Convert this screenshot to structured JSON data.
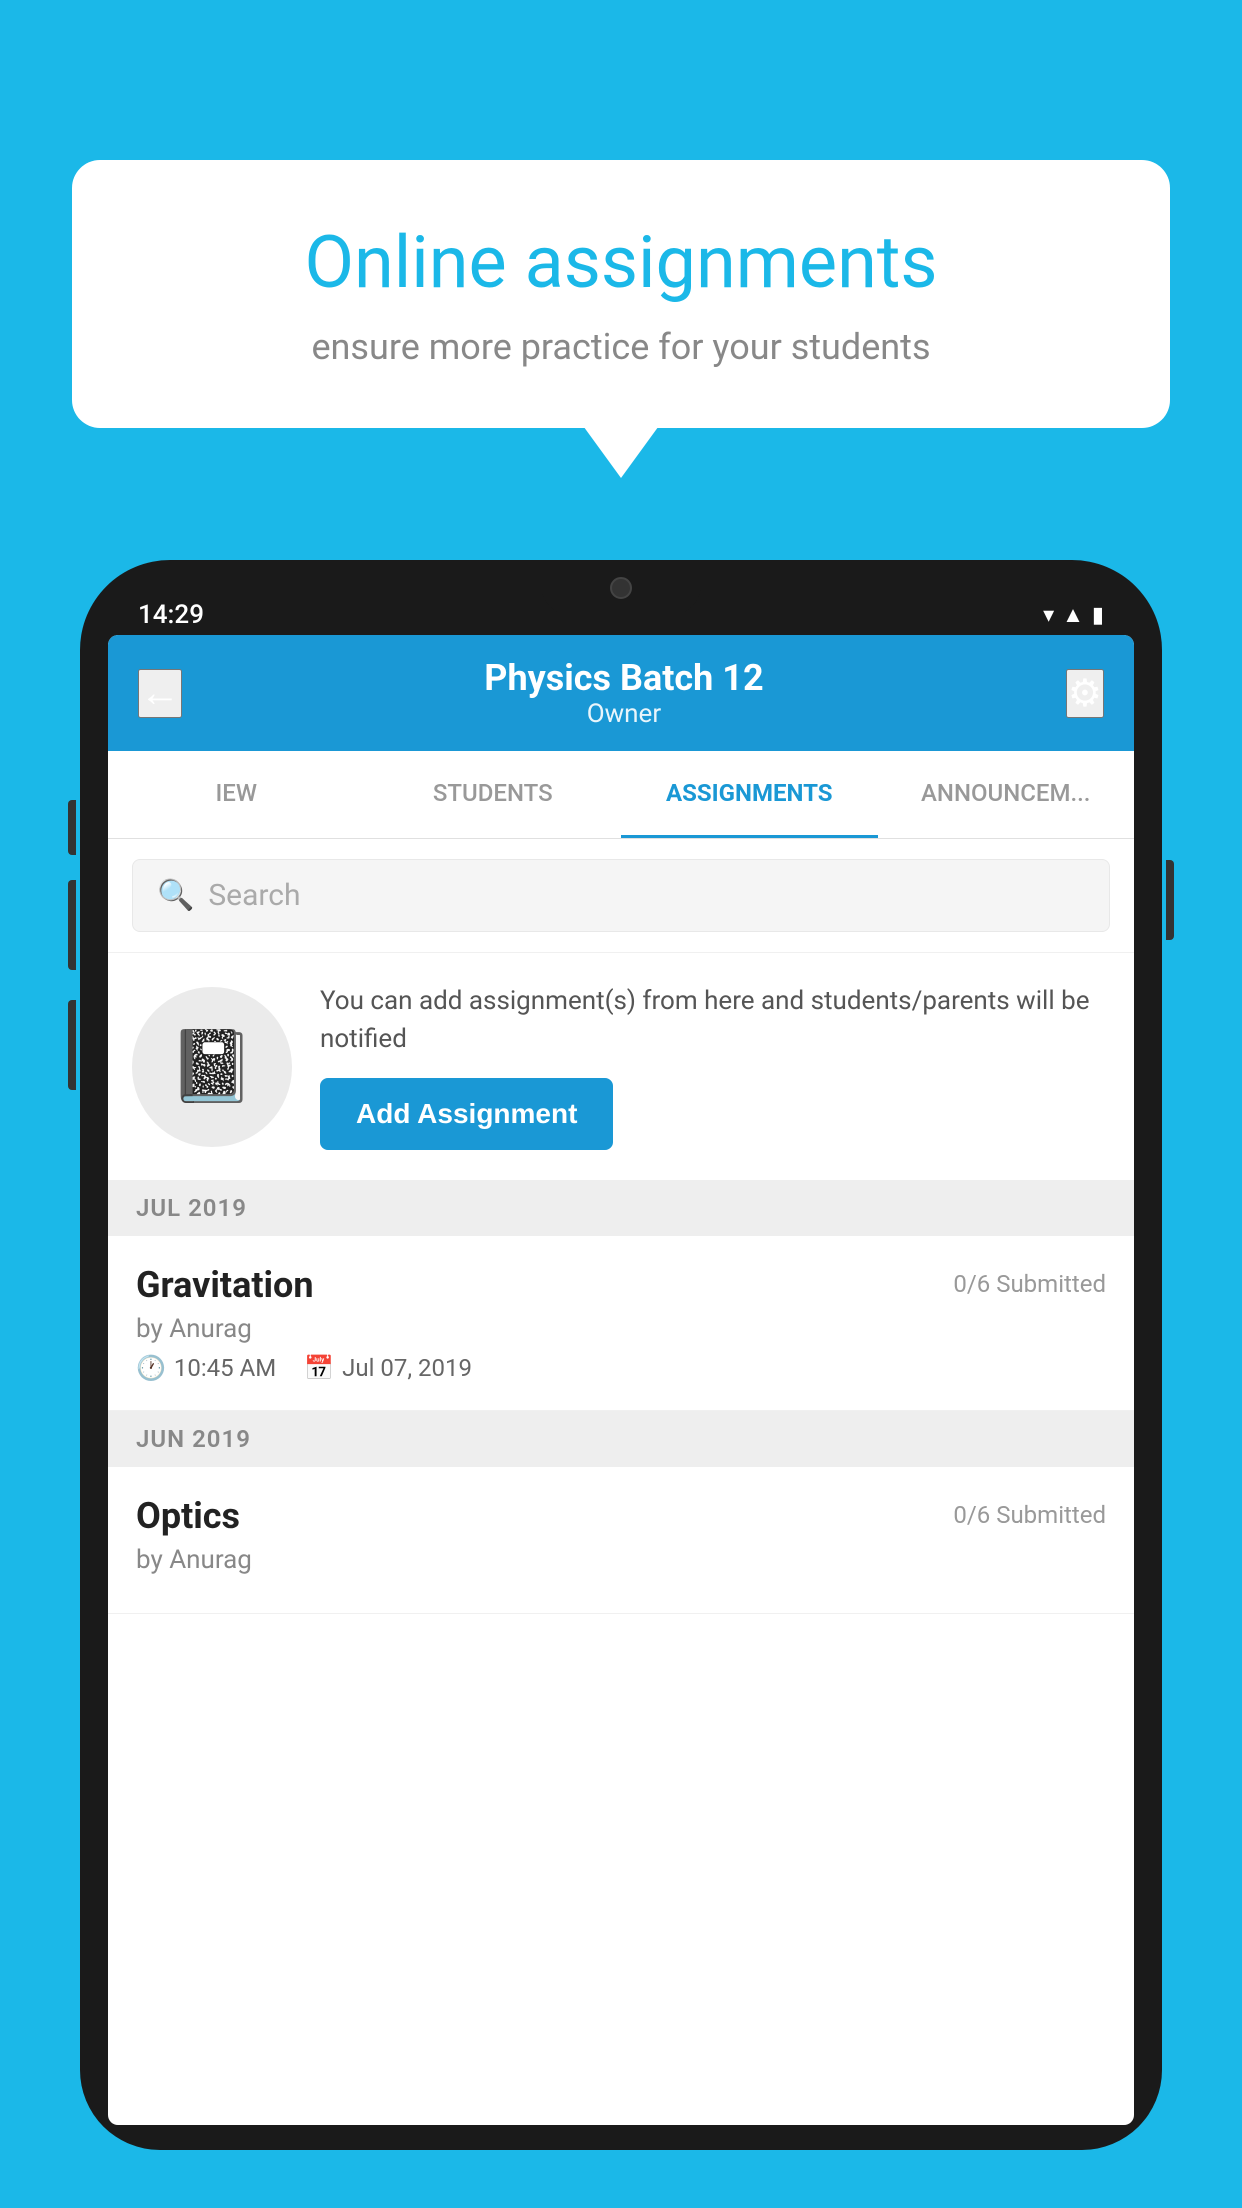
{
  "background_color": "#1bb8e8",
  "speech_bubble": {
    "title": "Online assignments",
    "subtitle": "ensure more practice for your students"
  },
  "phone": {
    "time": "14:29",
    "status_icons": [
      "wifi",
      "signal",
      "battery"
    ]
  },
  "app_header": {
    "title": "Physics Batch 12",
    "subtitle": "Owner",
    "back_label": "←",
    "settings_label": "⚙"
  },
  "tabs": [
    {
      "id": "iew",
      "label": "IEW",
      "active": false
    },
    {
      "id": "students",
      "label": "STUDENTS",
      "active": false
    },
    {
      "id": "assignments",
      "label": "ASSIGNMENTS",
      "active": true
    },
    {
      "id": "announcements",
      "label": "ANNOUNCEM...",
      "active": false
    }
  ],
  "search": {
    "placeholder": "Search"
  },
  "promo": {
    "description": "You can add assignment(s) from here and students/parents will be notified",
    "button_label": "Add Assignment"
  },
  "sections": [
    {
      "header": "JUL 2019",
      "assignments": [
        {
          "name": "Gravitation",
          "submitted": "0/6 Submitted",
          "by": "by Anurag",
          "time": "10:45 AM",
          "date": "Jul 07, 2019"
        }
      ]
    },
    {
      "header": "JUN 2019",
      "assignments": [
        {
          "name": "Optics",
          "submitted": "0/6 Submitted",
          "by": "by Anurag",
          "time": "",
          "date": ""
        }
      ]
    }
  ]
}
